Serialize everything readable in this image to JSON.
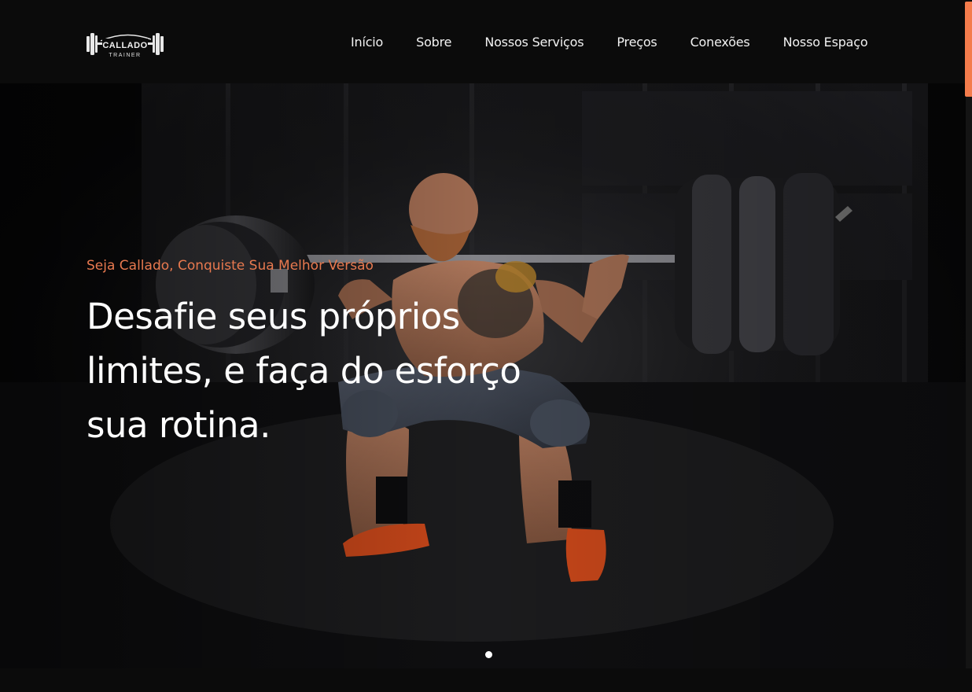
{
  "brand": {
    "logo_line1": "CALLADO",
    "logo_line2": "TRAINER"
  },
  "nav": {
    "items": [
      {
        "label": "Início"
      },
      {
        "label": "Sobre"
      },
      {
        "label": "Nossos Serviços"
      },
      {
        "label": "Preços"
      },
      {
        "label": "Conexões"
      },
      {
        "label": "Nosso Espaço"
      }
    ]
  },
  "hero": {
    "tagline": "Seja Callado, Conquiste Sua Melhor Versão",
    "headline": "Desafie seus próprios limites, e faça do esforço sua rotina.",
    "slides_count": 1,
    "active_slide": 1
  },
  "colors": {
    "accent": "#f47c4c",
    "tagline": "#e8794f",
    "shoe": "#e8521e"
  },
  "icons": {
    "logo": "dumbbell-logo-icon",
    "slider_dot": "slider-dot-icon"
  }
}
